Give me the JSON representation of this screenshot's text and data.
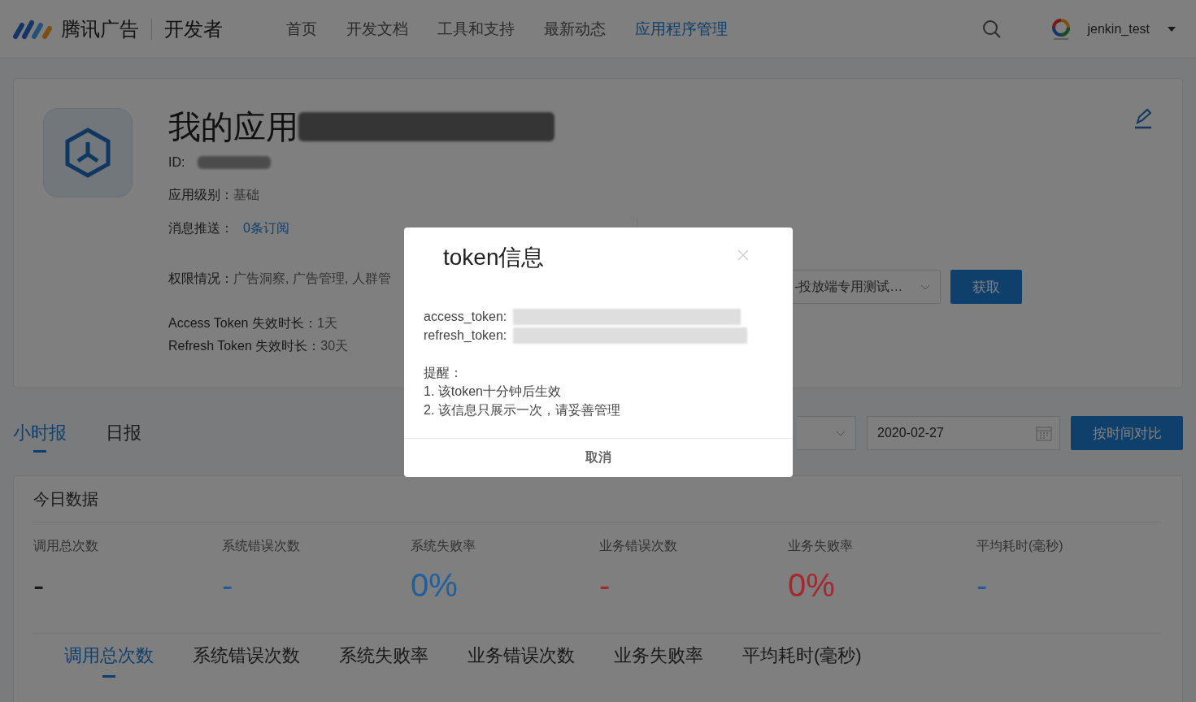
{
  "header": {
    "brand": "腾讯广告",
    "product": "开发者",
    "nav": [
      {
        "label": "首页",
        "selected": false
      },
      {
        "label": "开发文档",
        "selected": false
      },
      {
        "label": "工具和支持",
        "selected": false
      },
      {
        "label": "最新动态",
        "selected": false
      },
      {
        "label": "应用程序管理",
        "selected": true
      }
    ],
    "username": "jenkin_test"
  },
  "app_card": {
    "title": "我的应用",
    "id_label": "ID:",
    "fields": [
      {
        "label": "应用级别：",
        "value": "基础",
        "kind": "plain"
      },
      {
        "label": "消息推送：",
        "value": "0条订阅",
        "kind": "link"
      },
      {
        "label": "权限情况：",
        "value": "广告洞察, 广告管理, 人群管",
        "kind": "plain"
      },
      {
        "label": "Access Token 失效时长：",
        "value": "1天",
        "kind": "plain"
      },
      {
        "label": "Refresh Token 失效时长：",
        "value": "30天",
        "kind": "plain"
      }
    ],
    "account_select": "-投放端专用测试…",
    "fetch_button": "获取"
  },
  "report_tabs": [
    {
      "label": "小时报",
      "selected": true
    },
    {
      "label": "日报",
      "selected": false
    }
  ],
  "date_field": "2020-02-27",
  "compare_button": "按时间对比",
  "today": {
    "title": "今日数据",
    "stats": [
      {
        "label": "调用总次数",
        "value": "-",
        "color": "#1a1a1a"
      },
      {
        "label": "系统错误次数",
        "value": "-",
        "color": "#1f5f9e"
      },
      {
        "label": "系统失败率",
        "value": "0%",
        "color": "#1f5f9e"
      },
      {
        "label": "业务错误次数",
        "value": "-",
        "color": "#a5282e"
      },
      {
        "label": "业务失败率",
        "value": "0%",
        "color": "#a5282e"
      },
      {
        "label": "平均耗时(毫秒)",
        "value": "-",
        "color": "#1f5f9e"
      }
    ],
    "metric_tabs": [
      {
        "label": "调用总次数",
        "selected": true
      },
      {
        "label": "系统错误次数",
        "selected": false
      },
      {
        "label": "系统失败率",
        "selected": false
      },
      {
        "label": "业务错误次数",
        "selected": false
      },
      {
        "label": "业务失败率",
        "selected": false
      },
      {
        "label": "平均耗时(毫秒)",
        "selected": false
      }
    ]
  },
  "modal": {
    "title": "token信息",
    "tokens": [
      "access_token:",
      "refresh_token:"
    ],
    "notes": [
      "提醒：",
      "1. 该token十分钟后生效",
      "2. 该信息只展示一次，请妥善管理"
    ],
    "cancel": "取消"
  }
}
